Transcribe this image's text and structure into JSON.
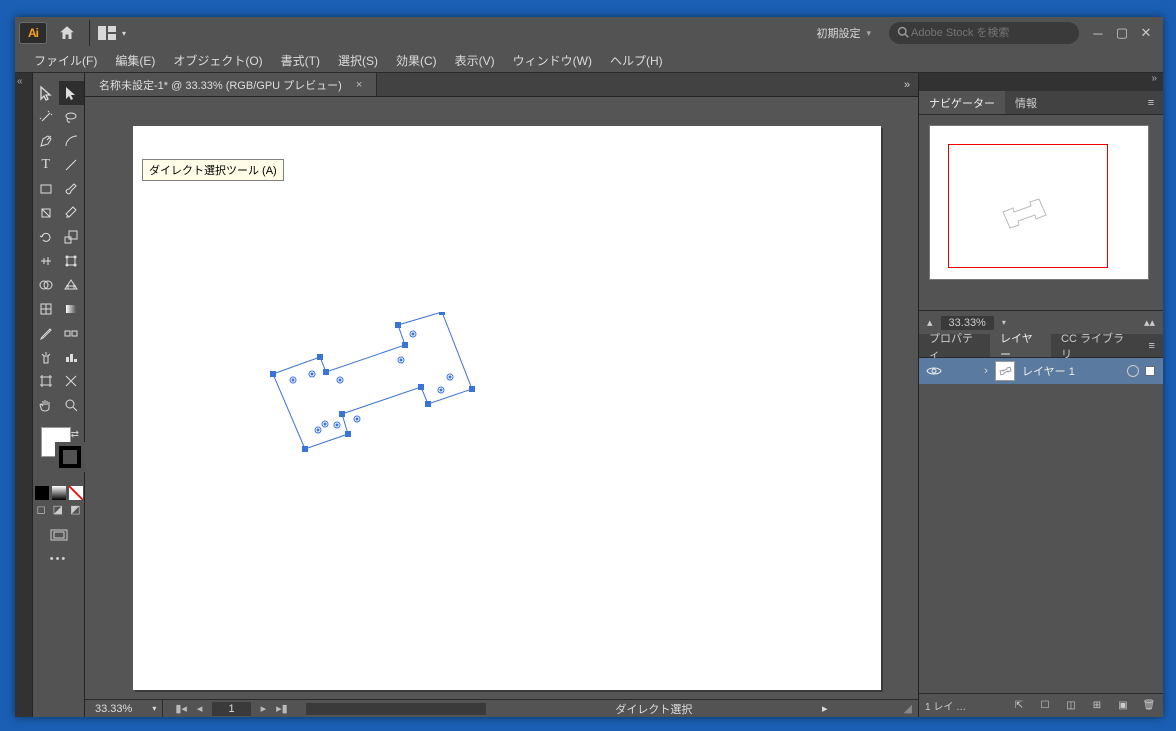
{
  "app": {
    "logo": "Ai"
  },
  "titlebar": {
    "workspace": "初期設定",
    "stock_placeholder": "Adobe Stock を検索"
  },
  "menu": {
    "file": "ファイル(F)",
    "edit": "編集(E)",
    "object": "オブジェクト(O)",
    "type": "書式(T)",
    "select": "選択(S)",
    "effect": "効果(C)",
    "view": "表示(V)",
    "window": "ウィンドウ(W)",
    "help": "ヘルプ(H)"
  },
  "document": {
    "tab_label": "名称未設定-1* @ 33.33% (RGB/GPU プレビュー)"
  },
  "tooltip": "ダイレクト選択ツール (A)",
  "status": {
    "zoom": "33.33%",
    "page": "1",
    "tool": "ダイレクト選択"
  },
  "panels": {
    "navigator": {
      "tab_nav": "ナビゲーター",
      "tab_info": "情報",
      "zoom": "33.33%"
    },
    "layers": {
      "tab_prop": "プロパティ",
      "tab_layers": "レイヤー",
      "tab_cc": "CC ライブラリ",
      "layer1": "レイヤー 1",
      "footer_count": "1 レイ …"
    }
  }
}
